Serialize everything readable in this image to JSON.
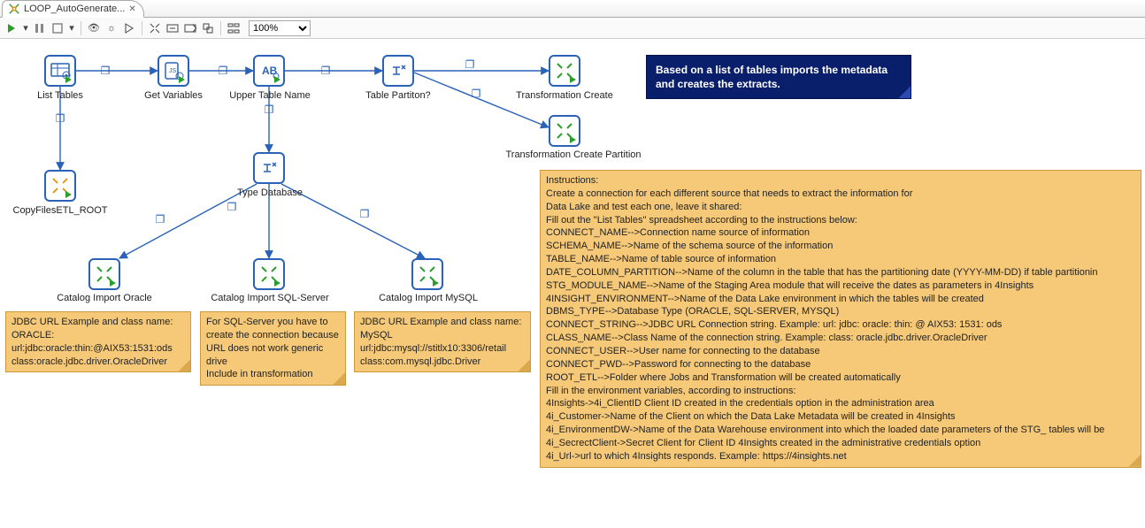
{
  "tab": {
    "title": "LOOP_AutoGenerate..."
  },
  "toolbar": {
    "zoom": "100%"
  },
  "nodes": {
    "list_tables": "List Tables",
    "get_variables": "Get Variables",
    "upper_table_name": "Upper Table Name",
    "table_partition": "Table Partiton?",
    "transformation_create": "Transformation Create",
    "copy_files_etl_root": "CopyFilesETL_ROOT",
    "type_database": "Type Database",
    "transformation_create_partition": "Transformation Create Partition",
    "catalog_import_oracle": "Catalog Import Oracle",
    "catalog_import_sqlserver": "Catalog Import SQL-Server",
    "catalog_import_mysql": "Catalog Import MySQL"
  },
  "banner": "Based on a list of tables imports the metadata and creates the extracts.",
  "note_oracle": "JDBC URL Example and class name:\nORACLE:\nurl:jdbc:oracle:thin:@AIX53:1531:ods\nclass:oracle.jdbc.driver.OracleDriver",
  "note_sqlserver": "For SQL-Server you have to create the connection because URL does not work generic drive\nInclude in transformation",
  "note_mysql": "JDBC URL Example and class name:\nMySQL\nurl:jdbc:mysql://stitlx10:3306/retail\nclass:com.mysql.jdbc.Driver",
  "instructions": [
    "Instructions:",
    "Create a connection for each different source that needs to extract the information for",
    "Data Lake and test each one, leave it shared:",
    "Fill out the \"List Tables\" spreadsheet according to the instructions below:",
    "CONNECT_NAME-->Connection name source of information",
    "SCHEMA_NAME-->Name of the schema source of the information",
    "TABLE_NAME-->Name of table source of information",
    "DATE_COLUMN_PARTITION-->Name of the column in the table that has the partitioning date (YYYY-MM-DD) if table partitionin",
    "STG_MODULE_NAME-->Name of the Staging Area module that will receive the dates as parameters in 4Insights",
    "4INSIGHT_ENVIRONMENT-->Name of the Data Lake environment in which the tables will be created",
    "DBMS_TYPE-->Database Type (ORACLE, SQL-SERVER, MYSQL)",
    "CONNECT_STRING-->JDBC URL Connection string. Example: url: jdbc: oracle: thin: @ AIX53: 1531: ods",
    "CLASS_NAME-->Class Name of the connection string. Example: class: oracle.jdbc.driver.OracleDriver",
    "CONNECT_USER-->User name for connecting to the database",
    "CONNECT_PWD-->Password for connecting to the database",
    "ROOT_ETL-->Folder where Jobs and Transformation will be created automatically",
    "Fill in the environment variables, according to instructions:",
    "4Insights->4i_ClientID Client ID created in the credentials option in the administration area",
    "4i_Customer->Name of the Client on which the Data Lake Metadata will be created in 4Insights",
    "4i_EnvironmentDW->Name of the Data Warehouse environment into which the loaded date parameters of the STG_ tables will be",
    "4i_SecrectClient->Secret Client for Client ID 4Insights created in the administrative credentials option",
    "4i_Url->url to which 4Insights responds. Example: https://4insights.net"
  ]
}
